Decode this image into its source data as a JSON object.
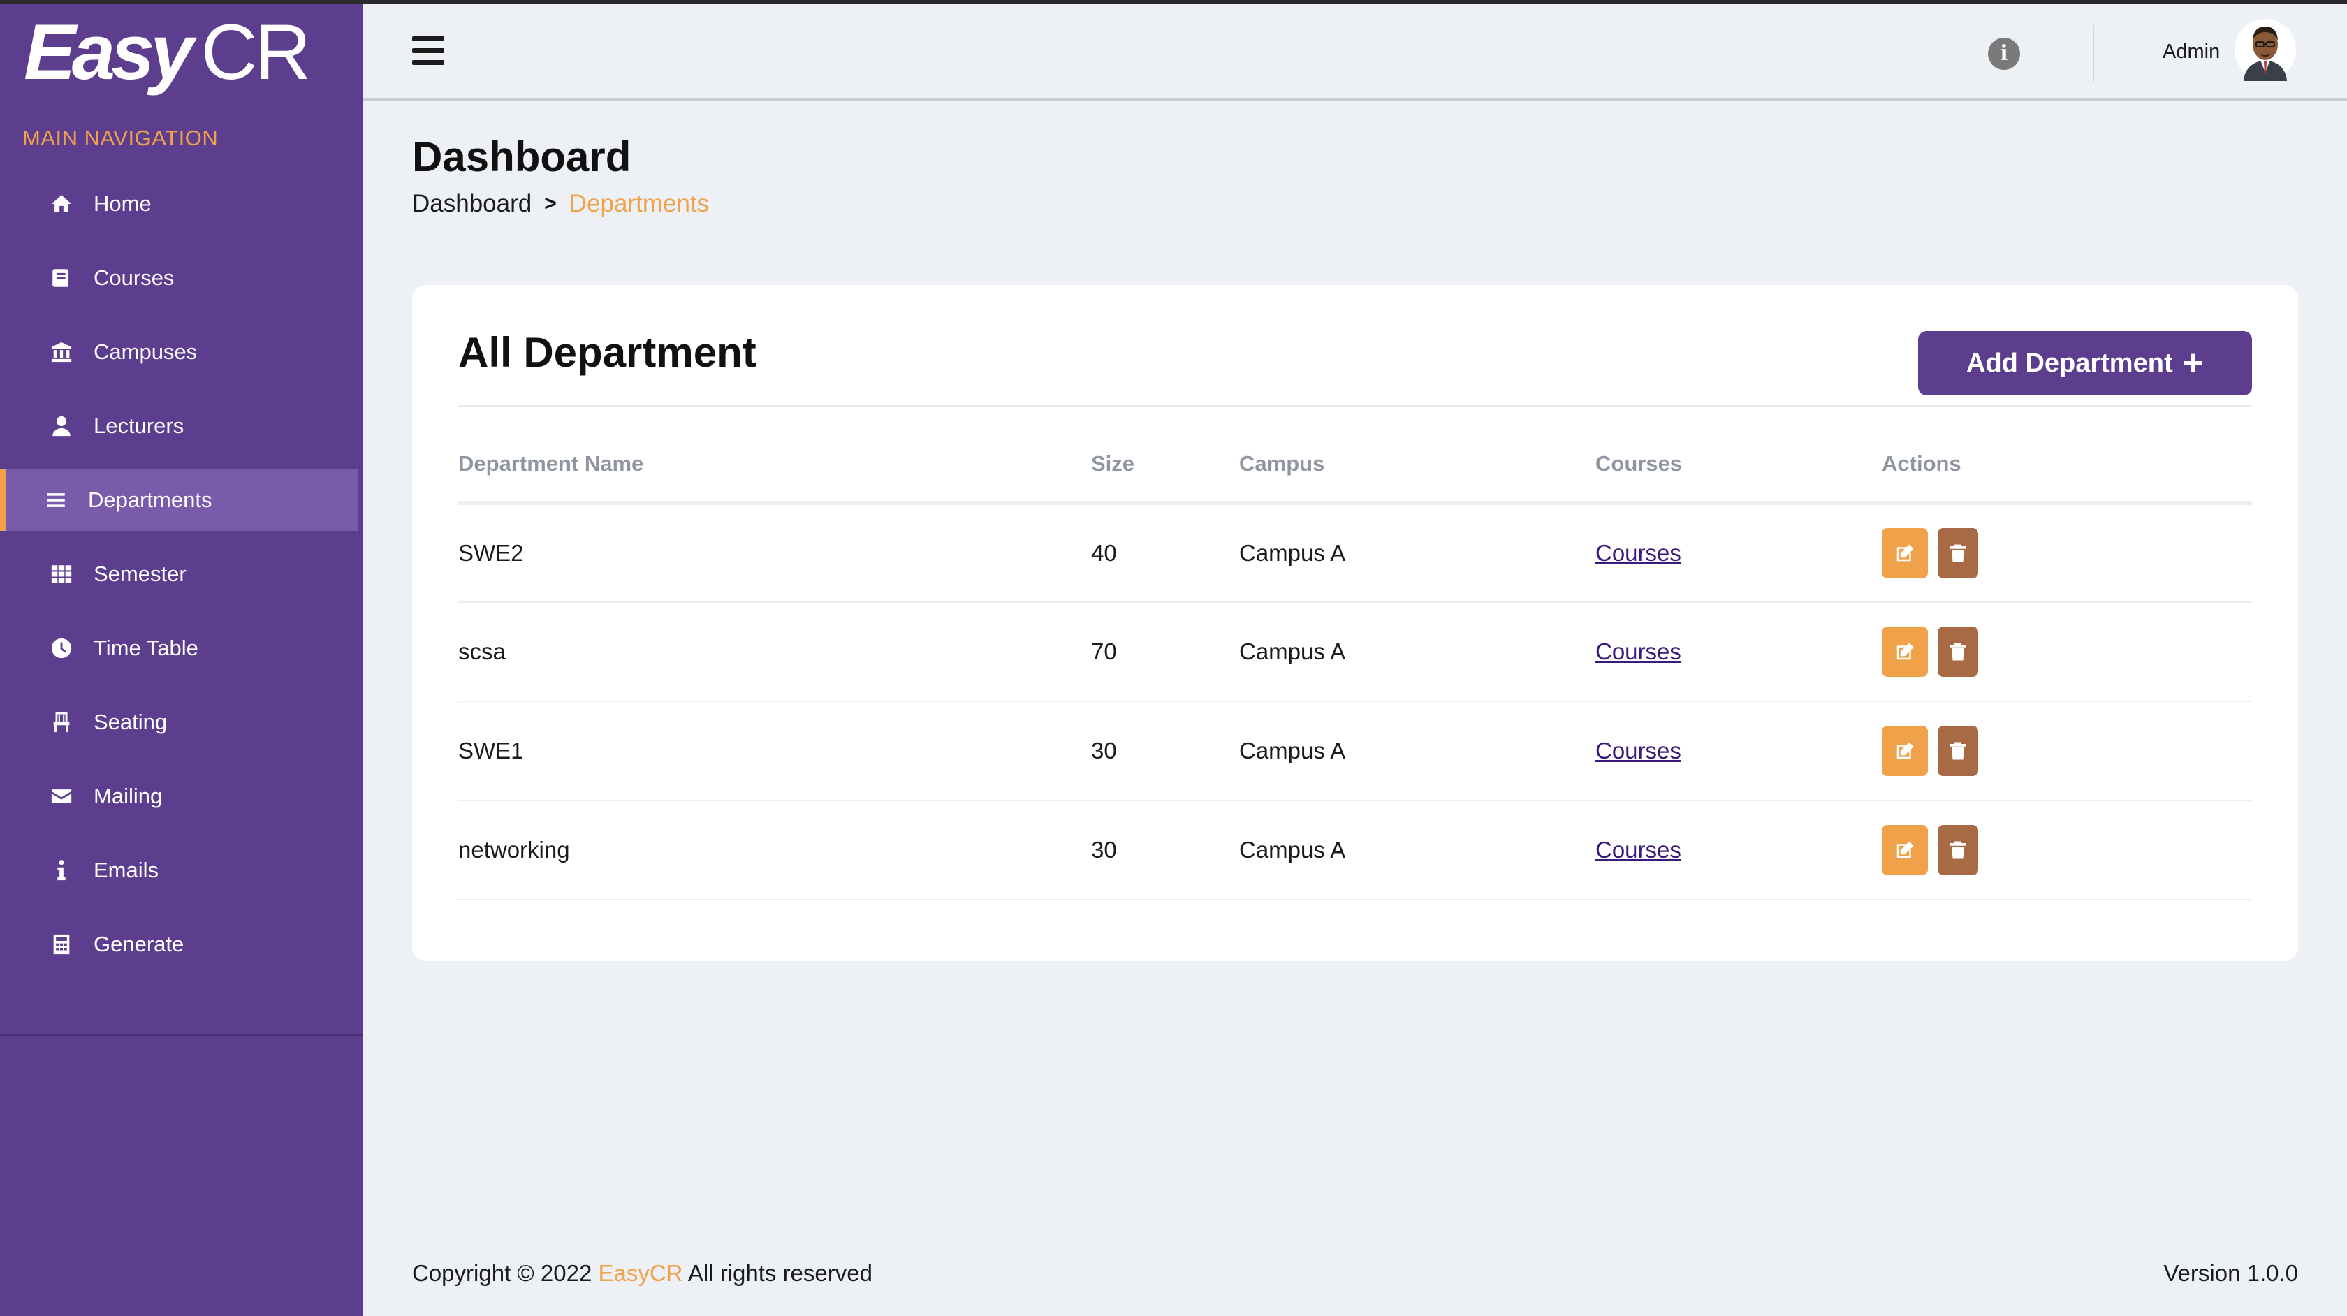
{
  "app": {
    "logo_easy": "Easy",
    "logo_cr": "CR"
  },
  "sidebar": {
    "header": "MAIN NAVIGATION",
    "items": [
      {
        "label": "Home",
        "icon": "home-icon"
      },
      {
        "label": "Courses",
        "icon": "book-icon"
      },
      {
        "label": "Campuses",
        "icon": "institution-icon"
      },
      {
        "label": "Lecturers",
        "icon": "user-icon"
      },
      {
        "label": "Departments",
        "icon": "list-icon",
        "active": true
      },
      {
        "label": "Semester",
        "icon": "grid-icon"
      },
      {
        "label": "Time Table",
        "icon": "clock-icon"
      },
      {
        "label": "Seating",
        "icon": "chair-icon"
      },
      {
        "label": "Mailing",
        "icon": "envelope-icon"
      },
      {
        "label": "Emails",
        "icon": "info-icon"
      },
      {
        "label": "Generate",
        "icon": "calculator-icon"
      }
    ]
  },
  "topbar": {
    "info_icon": "info-circle-icon",
    "admin_name": "Admin"
  },
  "page": {
    "title": "Dashboard",
    "breadcrumb": {
      "home": "Dashboard",
      "separator": ">",
      "current": "Departments"
    }
  },
  "card": {
    "title": "All Department",
    "add_button": "Add Department",
    "add_button_icon": "+",
    "columns": [
      "Department Name",
      "Size",
      "Campus",
      "Courses",
      "Actions"
    ],
    "rows": [
      {
        "name": "SWE2",
        "size": "40",
        "campus": "Campus A",
        "courses": "Courses"
      },
      {
        "name": "scsa",
        "size": "70",
        "campus": "Campus A",
        "courses": "Courses"
      },
      {
        "name": "SWE1",
        "size": "30",
        "campus": "Campus A",
        "courses": "Courses"
      },
      {
        "name": "networking",
        "size": "30",
        "campus": "Campus A",
        "courses": "Courses"
      }
    ]
  },
  "footer": {
    "copyright_prefix": "Copyright © 2022",
    "brand": "EasyCR",
    "copyright_suffix": "All rights reserved",
    "version": "Version 1.0.0"
  },
  "colors": {
    "sidebar": "#5d3d8e",
    "accent_orange": "#f0a24a",
    "delete_brown": "#a76a44",
    "background": "#edf0f4"
  }
}
